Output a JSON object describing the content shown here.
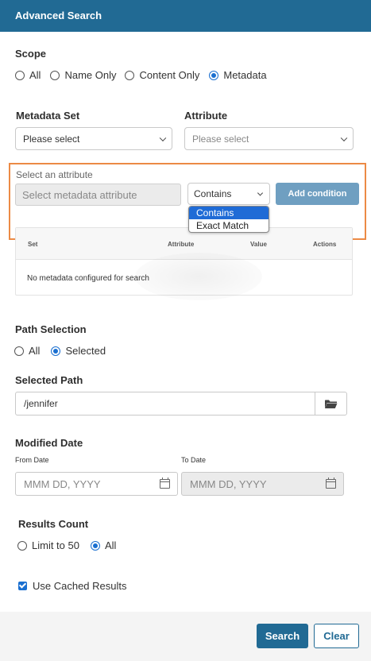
{
  "header": {
    "title": "Advanced Search"
  },
  "scope": {
    "label": "Scope",
    "options": [
      "All",
      "Name Only",
      "Content Only",
      "Metadata"
    ],
    "selected": "Metadata"
  },
  "metadata_set": {
    "label": "Metadata Set",
    "value": "Please select"
  },
  "attribute": {
    "label": "Attribute",
    "placeholder": "Please select"
  },
  "condition_builder": {
    "label": "Select an attribute",
    "attribute_placeholder": "Select metadata attribute",
    "operator_value": "Contains",
    "operator_options": [
      "Contains",
      "Exact Match"
    ],
    "add_button": "Add condition"
  },
  "conditions_table": {
    "columns": [
      "Set",
      "Attribute",
      "Value",
      "Actions"
    ],
    "empty_message": "No metadata configured for search"
  },
  "path_selection": {
    "label": "Path Selection",
    "options": [
      "All",
      "Selected"
    ],
    "selected": "Selected"
  },
  "selected_path": {
    "label": "Selected Path",
    "value": "/jennifer"
  },
  "modified_date": {
    "label": "Modified Date",
    "from_label": "From Date",
    "to_label": "To Date",
    "from_placeholder": "MMM DD, YYYY",
    "to_placeholder": "MMM DD, YYYY"
  },
  "results_count": {
    "label": "Results Count",
    "options": [
      "Limit to 50",
      "All"
    ],
    "selected": "All"
  },
  "cached": {
    "label": "Use Cached Results",
    "checked": true
  },
  "footer": {
    "search": "Search",
    "clear": "Clear"
  },
  "colors": {
    "header": "#216a94",
    "accent": "#1a6fd0",
    "highlight": "#ec8a45",
    "add_button": "#6f9fc1"
  }
}
